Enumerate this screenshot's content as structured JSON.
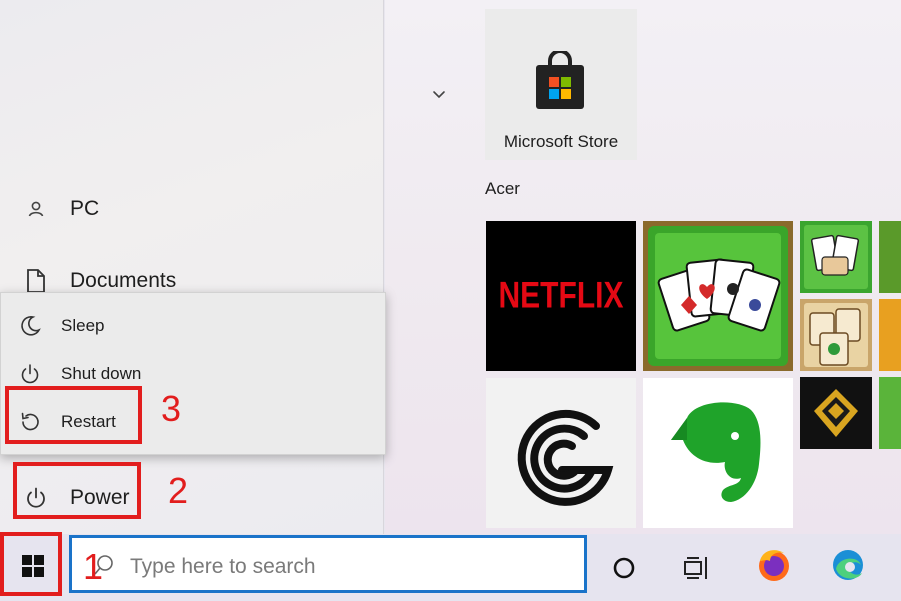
{
  "start_menu": {
    "nav": {
      "user_label": "PC",
      "documents_label": "Documents",
      "power_label": "Power"
    },
    "power_menu": {
      "items": [
        {
          "label": "Sleep",
          "icon": "moon-icon"
        },
        {
          "label": "Shut down",
          "icon": "power-icon"
        },
        {
          "label": "Restart",
          "icon": "restart-icon"
        }
      ]
    },
    "tiles": {
      "store_label": "Microsoft Store",
      "group_label": "Acer",
      "netflix_text": "NETFLIX"
    }
  },
  "annotations": {
    "step1": "1",
    "step2": "2",
    "step3": "3",
    "color": "#e21d1d"
  },
  "taskbar": {
    "search_placeholder": "Type here to search"
  },
  "colors": {
    "accent": "#1a73c9",
    "netflix_red": "#e50914",
    "evernote_green": "#1fa32a"
  }
}
